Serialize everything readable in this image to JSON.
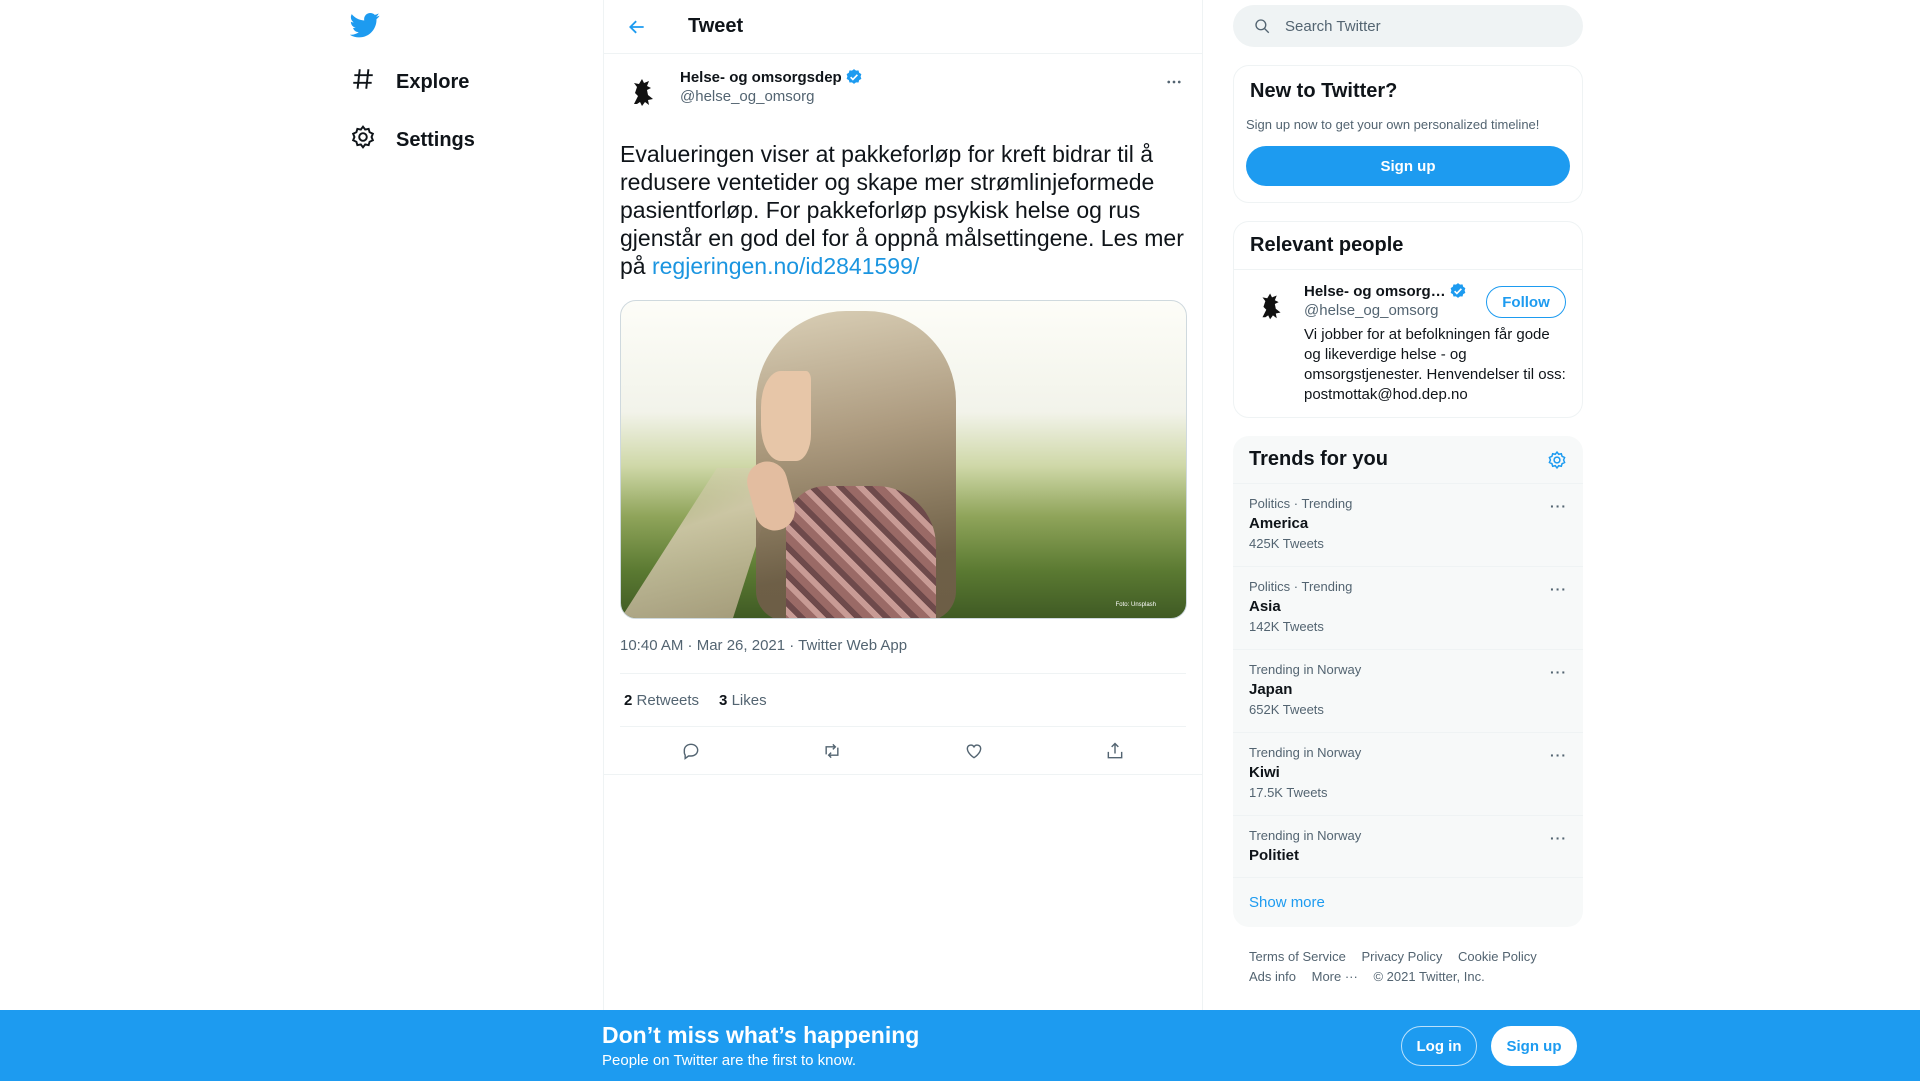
{
  "nav": {
    "explore_label": "Explore",
    "settings_label": "Settings"
  },
  "header": {
    "title": "Tweet"
  },
  "tweet": {
    "author_name": "Helse- og omsorgsdep",
    "author_handle": "@helse_og_omsorg",
    "text": "Evalueringen viser at pakkeforløp for kreft bidrar til å redusere ventetider og skape mer strømlinjeformede pasientforløp. For pakkeforløp psykisk helse og rus gjenstår en god del for å oppnå målsettingene. Les mer på ",
    "link": "regjeringen.no/id2841599/",
    "image_credit": "Foto: Unsplash",
    "timestamp": "10:40 AM · Mar 26, 2021 · Twitter Web App",
    "retweets_count": "2",
    "retweets_label": "Retweets",
    "likes_count": "3",
    "likes_label": "Likes"
  },
  "search": {
    "placeholder": "Search Twitter"
  },
  "new_to_twitter": {
    "title": "New to Twitter?",
    "subtitle": "Sign up now to get your own personalized timeline!",
    "signup_label": "Sign up"
  },
  "relevant_people": {
    "title": "Relevant people",
    "name": "Helse- og omsorg…",
    "handle": "@helse_og_omsorg",
    "follow_label": "Follow",
    "bio": "Vi jobber for at befolkningen får gode og likeverdige helse - og omsorgstjenester. Henvendelser til oss: postmottak@hod.dep.no"
  },
  "trends": {
    "title": "Trends for you",
    "items": [
      {
        "context": "Politics · Trending",
        "name": "America",
        "count": "425K Tweets"
      },
      {
        "context": "Politics · Trending",
        "name": "Asia",
        "count": "142K Tweets"
      },
      {
        "context": "Trending in Norway",
        "name": "Japan",
        "count": "652K Tweets"
      },
      {
        "context": "Trending in Norway",
        "name": "Kiwi",
        "count": "17.5K Tweets"
      },
      {
        "context": "Trending in Norway",
        "name": "Politiet",
        "count": ""
      }
    ],
    "show_more": "Show more"
  },
  "footer": {
    "terms": "Terms of Service",
    "privacy": "Privacy Policy",
    "cookie": "Cookie Policy",
    "ads": "Ads info",
    "more": "More ···",
    "copyright": "© 2021 Twitter, Inc."
  },
  "bottom_bar": {
    "title": "Don’t miss what’s happening",
    "subtitle": "People on Twitter are the first to know.",
    "login_label": "Log in",
    "signup_label": "Sign up"
  },
  "colors": {
    "accent": "#1d9bf0",
    "text": "#0f1419",
    "muted": "#536471"
  }
}
